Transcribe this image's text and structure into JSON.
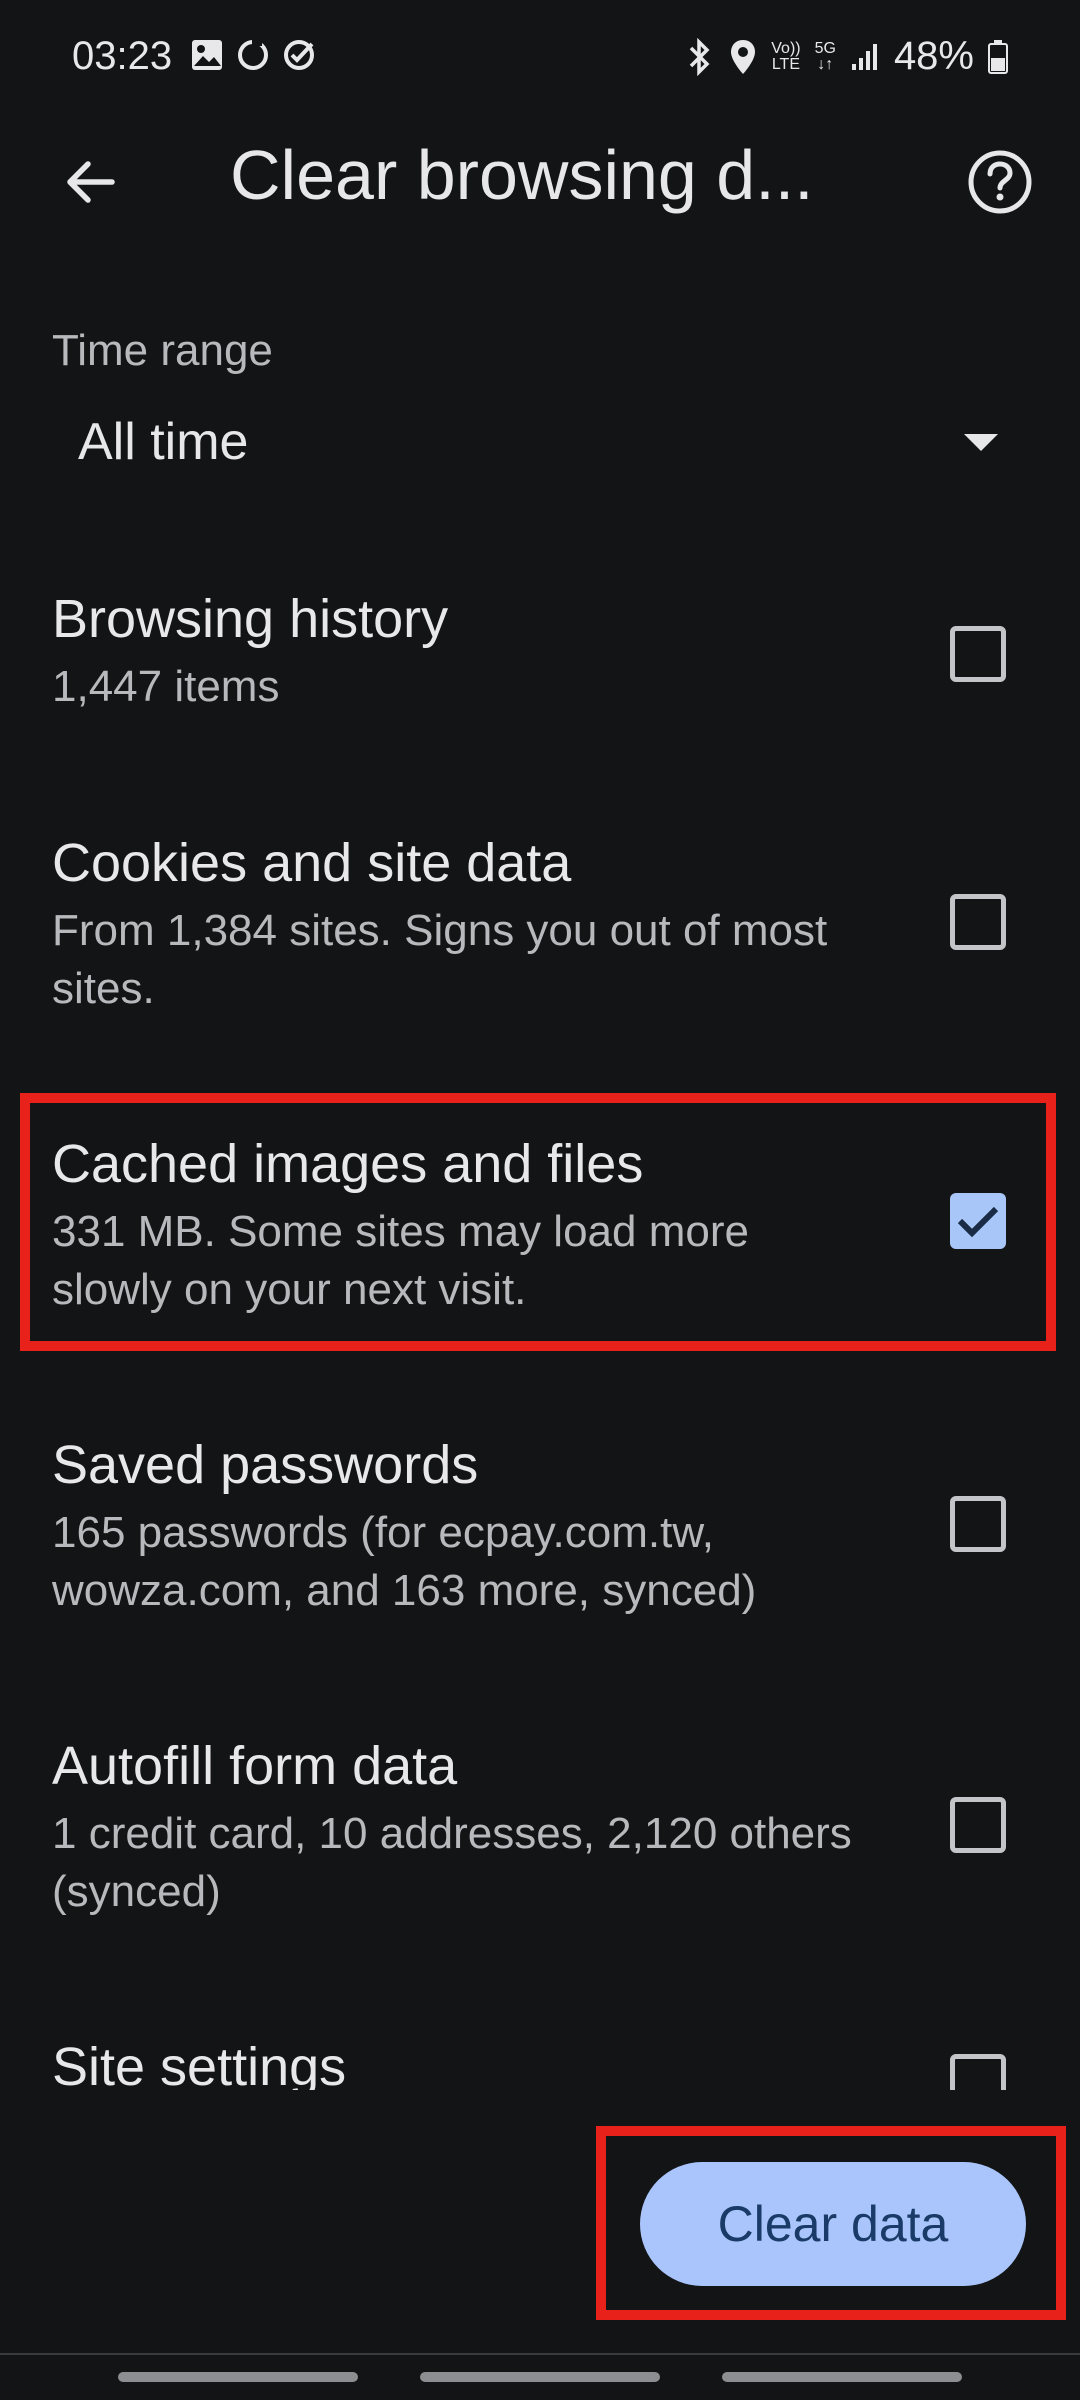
{
  "status_bar": {
    "time": "03:23",
    "left_icons": [
      "gallery-icon",
      "sync-ring-icon",
      "check-circle-icon"
    ],
    "volte_top": "Vo))",
    "volte_bottom": "LTE",
    "network_top": "5G",
    "network_bottom": "↓↑",
    "battery": "48%"
  },
  "app_bar": {
    "title": "Clear browsing d..."
  },
  "time_range": {
    "label": "Time range",
    "value": "All time"
  },
  "options": [
    {
      "title": "Browsing history",
      "desc": "1,447 items",
      "checked": false
    },
    {
      "title": "Cookies and site data",
      "desc": "From 1,384 sites. Signs you out of most sites.",
      "checked": false
    },
    {
      "title": "Cached images and files",
      "desc": "331 MB. Some sites may load more slowly on your next visit.",
      "checked": true
    },
    {
      "title": "Saved passwords",
      "desc": "165 passwords (for ecpay.com.tw, wowza.com, and 163 more, synced)",
      "checked": false
    },
    {
      "title": "Autofill form data",
      "desc": "1 credit card, 10 addresses, 2,120 others (synced)",
      "checked": false
    },
    {
      "title": "Site settings",
      "desc": "",
      "checked": false
    }
  ],
  "clear_button": {
    "label": "Clear data"
  },
  "colors": {
    "background": "#131416",
    "accent": "#a9c5fb",
    "highlight": "#e8221b"
  }
}
